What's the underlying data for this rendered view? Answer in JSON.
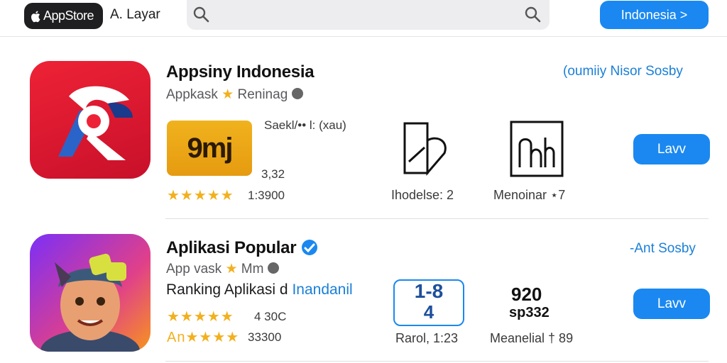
{
  "topbar": {
    "store_label": "AppStore",
    "layar_label": "A. Layar",
    "region_button": "Indonesia >"
  },
  "apps": [
    {
      "title": "Appsiny Indonesia",
      "subtitle_left": "Appkask",
      "subtitle_right": "Reninag",
      "link": "(oumiiy Nisor Sosby",
      "meta_label": "Saekl/•• l: (xau)",
      "tile_text": "9mj",
      "tile_number": "3,32",
      "rating_count": "1:3900",
      "stat1_label": "Ihodelse: 2",
      "stat2_label": "Menoinar ⋆7",
      "get_button": "Lavv"
    },
    {
      "title": "Aplikasi Popular",
      "subtitle_left": "App vask",
      "subtitle_right": "Mm",
      "link": "-Ant Sosby",
      "rank_prefix": "Ranking Aplikasi d",
      "rank_blue": "Inandanil",
      "rating_count1": "4 30C",
      "rating_prefix": "An",
      "rating_count2": "33300",
      "stat1_value_top": "1-8",
      "stat1_value_bottom": "4",
      "stat1_label": "Rarol, 1:23",
      "stat2_value_top": "920",
      "stat2_value_bottom": "sp332",
      "stat2_label": "Meanelial † 89",
      "get_button": "Lavv"
    }
  ],
  "colors": {
    "accent": "#1a88f0",
    "star": "#f2b01e",
    "link": "#1a7fd8"
  }
}
